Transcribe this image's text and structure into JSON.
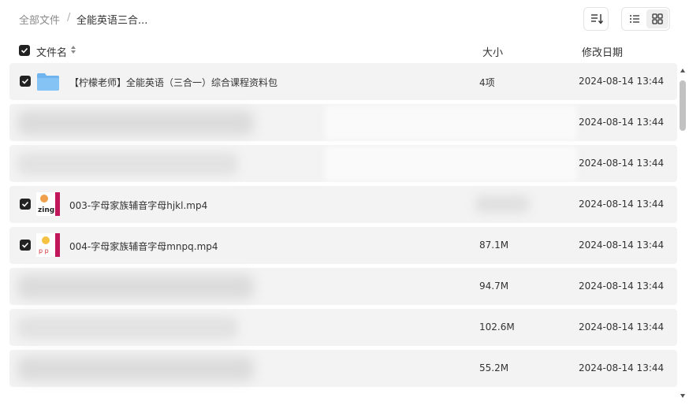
{
  "breadcrumb": {
    "root": "全部文件",
    "separator": "/",
    "current": "全能英语三合..."
  },
  "toolbar": {
    "sort_icon": "sort-icon",
    "list_view_icon": "list-view-icon",
    "grid_view_icon": "grid-view-icon"
  },
  "columns": {
    "name": "文件名",
    "size": "大小",
    "date": "修改日期"
  },
  "rows": [
    {
      "name": "【柠檬老师】全能英语（三合一）综合课程资料包",
      "size": "4项",
      "date": "2024-08-14 13:44",
      "type": "folder",
      "checked": true
    },
    {
      "name": "",
      "size": "",
      "date": "2024-08-14 13:44",
      "type": "blurred",
      "checked": false
    },
    {
      "name": "",
      "size": "",
      "date": "2024-08-14 13:44",
      "type": "blurred",
      "checked": false
    },
    {
      "name": "003-字母家族辅音字母hjkl.mp4",
      "size": "",
      "date": "2024-08-14 13:44",
      "type": "video",
      "checked": true
    },
    {
      "name": "004-字母家族辅音字母mnpq.mp4",
      "size": "87.1M",
      "date": "2024-08-14 13:44",
      "type": "video",
      "checked": true
    },
    {
      "name": "",
      "size": "94.7M",
      "date": "2024-08-14 13:44",
      "type": "blurred",
      "checked": false
    },
    {
      "name": "",
      "size": "102.6M",
      "date": "2024-08-14 13:44",
      "type": "blurred",
      "checked": false
    },
    {
      "name": "",
      "size": "55.2M",
      "date": "2024-08-14 13:44",
      "type": "blurred",
      "checked": false
    }
  ],
  "colors": {
    "row_bg": "#f3f3f3",
    "folder": "#6fb4ef",
    "checkbox": "#222222"
  }
}
